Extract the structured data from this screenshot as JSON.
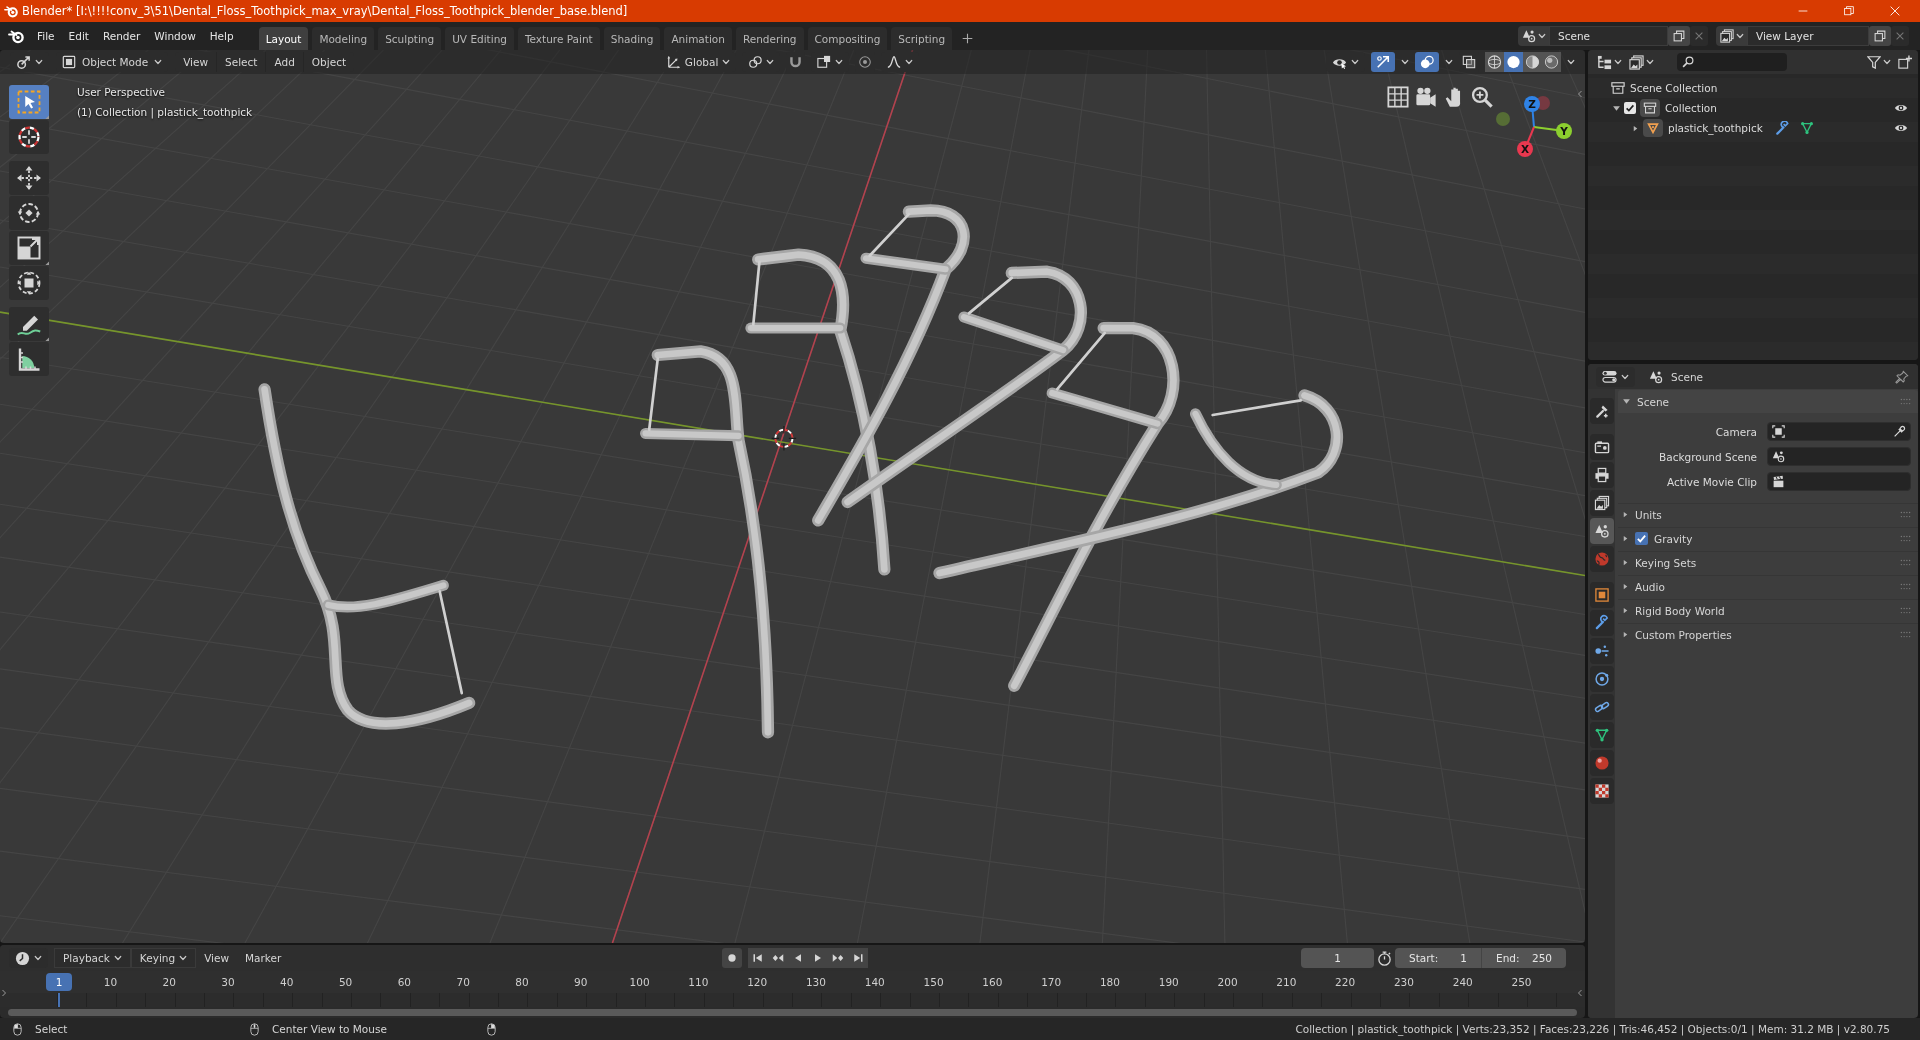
{
  "window": {
    "title": "Blender* [I:\\!!!!conv_3\\51\\Dental_Floss_Toothpick_max_vray\\Dental_Floss_Toothpick_blender_base.blend]"
  },
  "menu": [
    "File",
    "Edit",
    "Render",
    "Window",
    "Help"
  ],
  "workspaces": [
    {
      "label": "Layout",
      "selected": true
    },
    {
      "label": "Modeling",
      "selected": false
    },
    {
      "label": "Sculpting",
      "selected": false
    },
    {
      "label": "UV Editing",
      "selected": false
    },
    {
      "label": "Texture Paint",
      "selected": false
    },
    {
      "label": "Shading",
      "selected": false
    },
    {
      "label": "Animation",
      "selected": false
    },
    {
      "label": "Rendering",
      "selected": false
    },
    {
      "label": "Compositing",
      "selected": false
    },
    {
      "label": "Scripting",
      "selected": false
    }
  ],
  "scene_selector": {
    "value": "Scene"
  },
  "view_layer_selector": {
    "value": "View Layer"
  },
  "viewport": {
    "mode": "Object Mode",
    "menus": [
      "View",
      "Select",
      "Add",
      "Object"
    ],
    "orientation": "Global",
    "show_gizmos": true,
    "show_overlays": true,
    "shading": [
      {
        "selected": false
      },
      {
        "selected": true
      },
      {
        "selected": false
      },
      {
        "selected": false
      }
    ],
    "tools": [
      {
        "selected": true
      },
      {
        "selected": false
      },
      {
        "selected": false
      },
      {
        "selected": false
      },
      {
        "selected": false
      },
      {
        "selected": false
      },
      {
        "selected": false
      },
      {
        "selected": false
      }
    ],
    "view_name": "User Perspective",
    "context": "(1) Collection | plastick_toothpick",
    "gizmo_axes": [
      {
        "label": "Z",
        "color": "#2f83e6"
      },
      {
        "label": "Y",
        "color": "#8ccf2f"
      },
      {
        "label": "X",
        "color": "#e8384f"
      }
    ]
  },
  "outliner": {
    "items": [
      {
        "label": "Scene Collection",
        "kind": "scene_collection",
        "selected": false,
        "children": [
          {
            "label": "Collection",
            "kind": "collection",
            "selected": false,
            "expanded": true,
            "checked": true,
            "visible": true,
            "children": [
              {
                "label": "plastick_toothpick",
                "kind": "mesh_object",
                "selected": false,
                "expanded": false,
                "visible": true
              }
            ]
          }
        ]
      }
    ]
  },
  "properties": {
    "context": "Scene",
    "tabs": [
      {
        "selected": false
      },
      {
        "selected": false
      },
      {
        "selected": false
      },
      {
        "selected": false
      },
      {
        "selected": true
      },
      {
        "selected": false
      },
      {
        "selected": false
      },
      {
        "selected": false
      },
      {
        "selected": false
      },
      {
        "selected": false
      },
      {
        "selected": false
      },
      {
        "selected": false
      },
      {
        "selected": false
      },
      {
        "selected": false
      }
    ],
    "panels": [
      {
        "kind": "panel",
        "label": "Scene",
        "expanded": true,
        "fields": [
          {
            "label": "Camera"
          },
          {
            "label": "Background Scene"
          },
          {
            "label": "Active Movie Clip"
          }
        ]
      },
      {
        "kind": "panel",
        "label": "Units",
        "expanded": false
      },
      {
        "kind": "toggle_panel",
        "label": "Gravity",
        "expanded": false,
        "checked": true
      },
      {
        "kind": "panel",
        "label": "Keying Sets",
        "expanded": false
      },
      {
        "kind": "panel",
        "label": "Audio",
        "expanded": false
      },
      {
        "kind": "panel",
        "label": "Rigid Body World",
        "expanded": false
      },
      {
        "kind": "panel",
        "label": "Custom Properties",
        "expanded": false
      }
    ]
  },
  "timeline": {
    "menus": [
      {
        "label": "Playback",
        "kind": "dropdown"
      },
      {
        "label": "Keying",
        "kind": "dropdown"
      },
      {
        "label": "View",
        "kind": "menu"
      },
      {
        "label": "Marker",
        "kind": "menu"
      }
    ],
    "current_frame": "1",
    "start_label": "Start:",
    "start": "1",
    "end_label": "End:",
    "end": "250",
    "ruler": [
      "10",
      "20",
      "30",
      "40",
      "50",
      "60",
      "70",
      "80",
      "90",
      "100",
      "110",
      "120",
      "130",
      "140",
      "150",
      "160",
      "170",
      "180",
      "190",
      "200",
      "210",
      "220",
      "230",
      "240",
      "250"
    ],
    "playhead": "1"
  },
  "status_bar": {
    "hints": [
      "Select",
      "Center View to Mouse"
    ],
    "stats": "Collection | plastick_toothpick | Verts:23,352 | Faces:23,226 | Tris:46,452 | Objects:0/1 | Mem: 31.2 MB | v2.80.75"
  }
}
